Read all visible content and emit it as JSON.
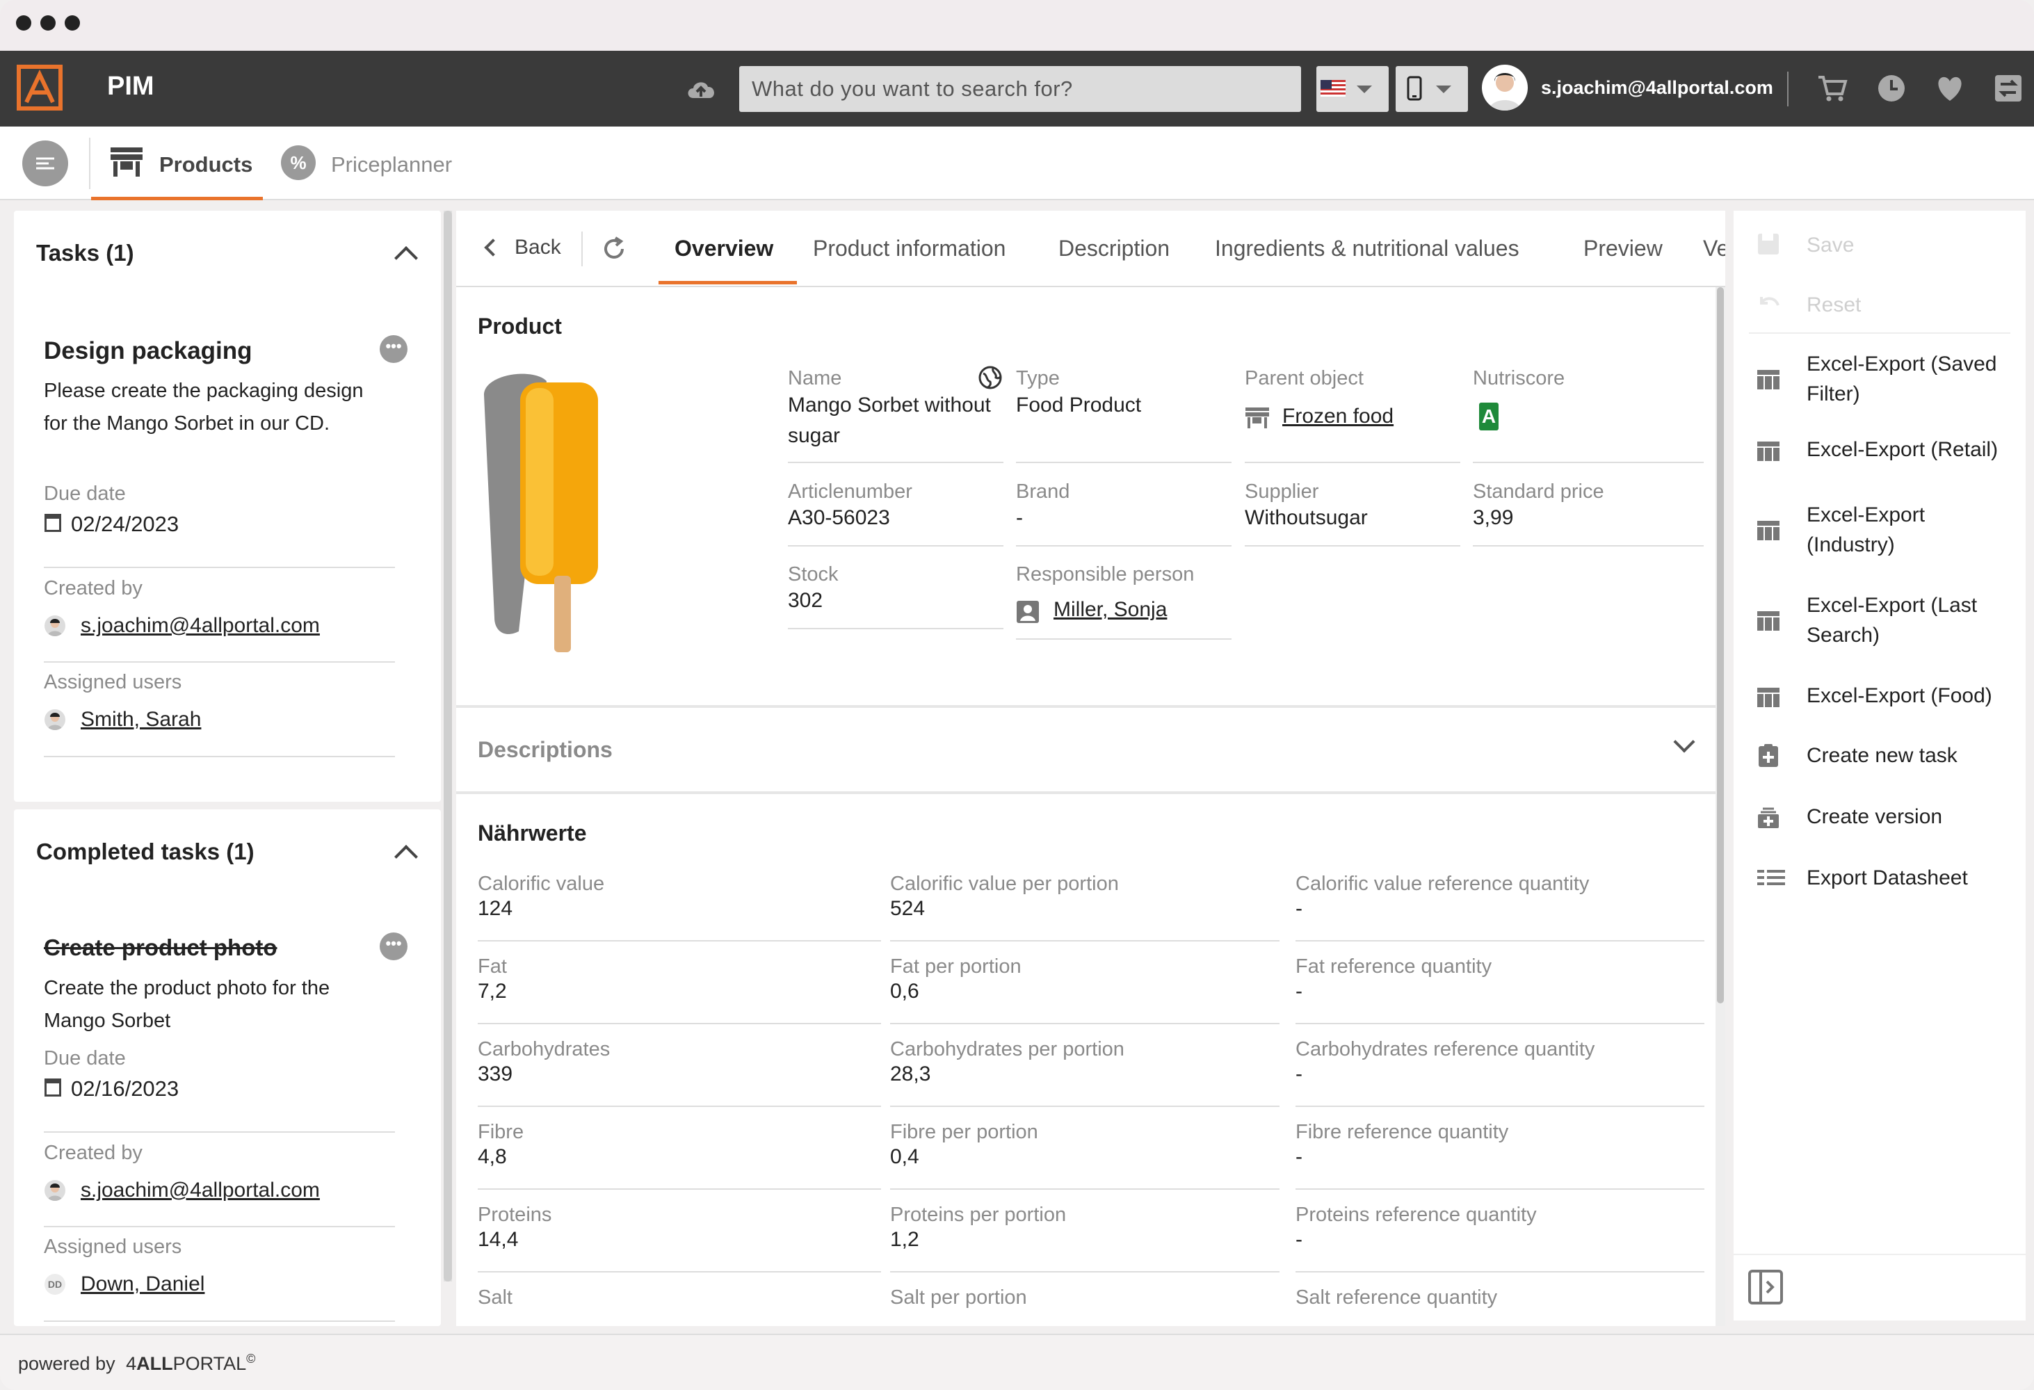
{
  "app": {
    "title": "PIM"
  },
  "search": {
    "placeholder": "What do you want to search for?"
  },
  "user": {
    "email": "s.joachim@4allportal.com"
  },
  "nav": {
    "products": "Products",
    "priceplanner": "Priceplanner",
    "priceplanner_glyph": "%"
  },
  "tasks": {
    "header": "Tasks (1)",
    "item": {
      "title": "Design packaging",
      "description": "Please create the packaging design for the Mango Sorbet in our CD.",
      "due_label": "Due date",
      "due": "02/24/2023",
      "created_label": "Created by",
      "created_by": "s.joachim@4allportal.com",
      "assigned_label": "Assigned users",
      "assigned": "Smith, Sarah"
    }
  },
  "completed": {
    "header": "Completed tasks (1)",
    "item": {
      "title": "Create product photo",
      "description": "Create the product photo for the Mango Sorbet",
      "due_label": "Due date",
      "due": "02/16/2023",
      "created_label": "Created by",
      "created_by": "s.joachim@4allportal.com",
      "assigned_label": "Assigned users",
      "assigned_initials": "DD",
      "assigned": "Down, Daniel"
    }
  },
  "main_tabs": {
    "back": "Back",
    "overview": "Overview",
    "product_information": "Product information",
    "description": "Description",
    "ingredients": "Ingredients & nutritional values",
    "preview": "Preview",
    "more": "Ve"
  },
  "product": {
    "section": "Product",
    "name_label": "Name",
    "name": "Mango Sorbet without sugar",
    "type_label": "Type",
    "type": "Food Product",
    "parent_label": "Parent object",
    "parent": "Frozen food",
    "nutriscore_label": "Nutriscore",
    "nutriscore": "A",
    "article_label": "Articlenumber",
    "article": "A30-56023",
    "brand_label": "Brand",
    "brand": "-",
    "supplier_label": "Supplier",
    "supplier": "Withoutsugar",
    "price_label": "Standard price",
    "price": "3,99",
    "stock_label": "Stock",
    "stock": "302",
    "responsible_label": "Responsible person",
    "responsible": "Miller, Sonja"
  },
  "descriptions": {
    "section": "Descriptions"
  },
  "nutrition": {
    "section": "Nährwerte",
    "rows": [
      {
        "label": "Calorific value",
        "value": "124",
        "portion_label": "Calorific value per portion",
        "portion": "524",
        "ref_label": "Calorific value reference quantity",
        "ref": "-"
      },
      {
        "label": "Fat",
        "value": "7,2",
        "portion_label": "Fat per portion",
        "portion": "0,6",
        "ref_label": "Fat reference quantity",
        "ref": "-"
      },
      {
        "label": "Carbohydrates",
        "value": "339",
        "portion_label": "Carbohydrates per portion",
        "portion": "28,3",
        "ref_label": "Carbohydrates reference quantity",
        "ref": "-"
      },
      {
        "label": "Fibre",
        "value": "4,8",
        "portion_label": "Fibre per portion",
        "portion": "0,4",
        "ref_label": "Fibre reference quantity",
        "ref": "-"
      },
      {
        "label": "Proteins",
        "value": "14,4",
        "portion_label": "Proteins per portion",
        "portion": "1,2",
        "ref_label": "Proteins reference quantity",
        "ref": "-"
      },
      {
        "label": "Salt",
        "portion_label": "Salt per portion",
        "ref_label": "Salt reference quantity"
      }
    ]
  },
  "actions": {
    "save": "Save",
    "reset": "Reset",
    "excel_saved": "Excel-Export (Saved Filter)",
    "excel_retail": "Excel-Export (Retail)",
    "excel_industry": "Excel-Export (Industry)",
    "excel_last": "Excel-Export (Last Search)",
    "excel_food": "Excel-Export (Food)",
    "new_task": "Create new task",
    "new_version": "Create version",
    "export_datasheet": "Export Datasheet"
  },
  "footer": {
    "powered": "powered by",
    "brand_prefix": "4",
    "brand_bold": "ALL",
    "brand_rest": "PORTAL",
    "copyright": "©"
  },
  "colors": {
    "accent": "#e9732c",
    "topbar": "#3a3a3a",
    "nutriscore": "#1f8a3a"
  }
}
